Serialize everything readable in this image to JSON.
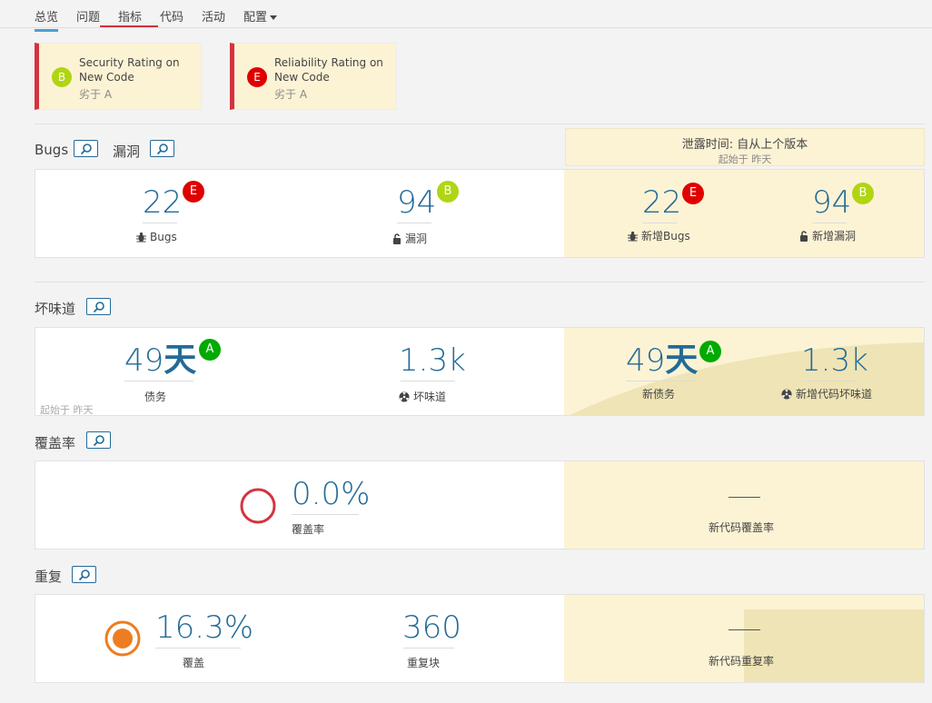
{
  "nav": {
    "items": [
      {
        "label": "总览",
        "active": true
      },
      {
        "label": "问题",
        "active": false
      },
      {
        "label": "指标",
        "active": false
      },
      {
        "label": "代码",
        "active": false
      },
      {
        "label": "活动",
        "active": false
      },
      {
        "label": "配置",
        "active": false
      }
    ]
  },
  "colors": {
    "rating_a": "#00aa00",
    "rating_b": "#b0d513",
    "rating_e": "#d4333f",
    "accent": "#236a97",
    "leak_bg": "#fcf3d5",
    "error": "#d4333f",
    "duplication": "#ed7d20"
  },
  "quality_gate": [
    {
      "rating": "B",
      "title": "Security Rating on New Code",
      "sub": "劣于 A"
    },
    {
      "rating": "E",
      "title": "Reliability Rating on New Code",
      "sub": "劣于 A"
    }
  ],
  "leak": {
    "title": "泄露时间: 自从上个版本",
    "sub": "起始于 昨天"
  },
  "bugs_section": {
    "title_bugs": "Bugs",
    "title_vuln": "漏洞",
    "bugs": {
      "value": "22",
      "rating": "E",
      "label": "Bugs"
    },
    "vulns": {
      "value": "94",
      "rating": "B",
      "label": "漏洞"
    },
    "new_bugs": {
      "value": "22",
      "rating": "E",
      "label": "新增Bugs"
    },
    "new_vulns": {
      "value": "94",
      "rating": "B",
      "label": "新增漏洞"
    }
  },
  "smells_section": {
    "title": "坏味道",
    "debt": {
      "value": "49",
      "unit": "天",
      "rating": "A",
      "label": "债务"
    },
    "smells": {
      "value": "1.3k",
      "label": "坏味道"
    },
    "note": "起始于 昨天",
    "new_debt": {
      "value": "49",
      "unit": "天",
      "rating": "A",
      "label": "新债务"
    },
    "new_smells": {
      "value": "1.3k",
      "label": "新增代码坏味道"
    }
  },
  "coverage_section": {
    "title": "覆盖率",
    "coverage": {
      "value": "0.0%",
      "label": "覆盖率"
    },
    "new_coverage": {
      "label": "新代码覆盖率"
    }
  },
  "dup_section": {
    "title": "重复",
    "dup": {
      "value": "16.3%",
      "label": "覆盖"
    },
    "blocks": {
      "value": "360",
      "label": "重复块"
    },
    "new_dup": {
      "label": "新代码重复率"
    }
  }
}
